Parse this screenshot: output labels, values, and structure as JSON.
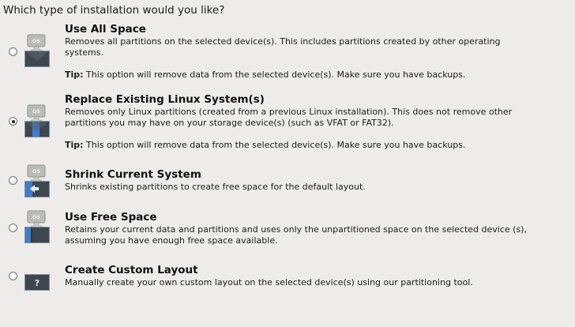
{
  "question": "Which type of installation would you like?",
  "options": [
    {
      "title": "Use All Space",
      "description": "Removes all partitions on the selected device(s).  This includes partitions created by other operating systems.",
      "tip_label": "Tip:",
      "tip_text": "This option will remove data from the selected device(s).  Make sure you have backups.",
      "selected": false,
      "icon": "drive-use-all-space-icon"
    },
    {
      "title": "Replace Existing Linux System(s)",
      "description": "Removes only Linux partitions (created from a previous Linux installation).  This does not remove other partitions you may have on your storage device(s) (such as VFAT or FAT32).",
      "tip_label": "Tip:",
      "tip_text": "This option will remove data from the selected device(s).  Make sure you have backups.",
      "selected": true,
      "icon": "drive-replace-linux-icon"
    },
    {
      "title": "Shrink Current System",
      "description": "Shrinks existing partitions to create free space for the default layout.",
      "selected": false,
      "icon": "drive-shrink-icon"
    },
    {
      "title": "Use Free Space",
      "description": "Retains your current data and partitions and uses only the unpartitioned space on the selected device (s), assuming you have enough free space available.",
      "selected": false,
      "icon": "drive-free-space-icon"
    },
    {
      "title": "Create Custom Layout",
      "description": "Manually create your own custom layout on the selected device(s) using our partitioning tool.",
      "selected": false,
      "icon": "drive-custom-layout-icon"
    }
  ],
  "icon_badge_text": "OS",
  "custom_icon_glyph": "?",
  "colors": {
    "background": "#edeceb",
    "drive_dark": "#3e4650",
    "drive_blue": "#3f7ccc",
    "badge": "#b9bdb6"
  }
}
